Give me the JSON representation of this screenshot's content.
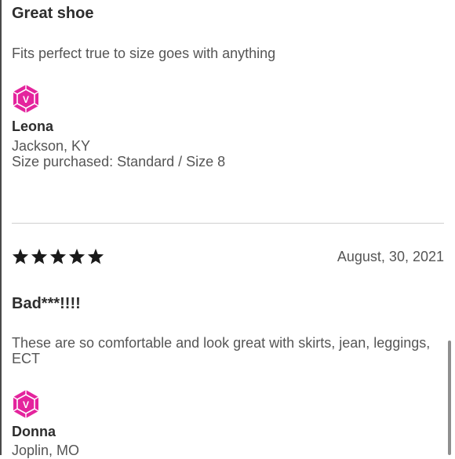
{
  "colors": {
    "badge": "#e4249d",
    "title_text": "#2d2d2d",
    "body_text": "#555555",
    "divider": "#cfcfcf",
    "star": "#1a1a1a"
  },
  "reviews": [
    {
      "title": "Great shoe",
      "body": "Fits perfect true to size goes with anything",
      "badge_icon": "vip-hexagon-badge-icon",
      "badge_letter": "V",
      "reviewer_name": "Leona",
      "location": "Jackson, KY",
      "size_purchased": "Size purchased: Standard / Size 8"
    },
    {
      "rating": 5,
      "rating_max": 5,
      "date": "August, 30, 2021",
      "title": "Bad***!!!!",
      "body": "These are so comfortable and look great with skirts, jean, leggings, ECT",
      "badge_icon": "vip-hexagon-badge-icon",
      "badge_letter": "V",
      "reviewer_name": "Donna",
      "location": "Joplin, MO"
    }
  ]
}
